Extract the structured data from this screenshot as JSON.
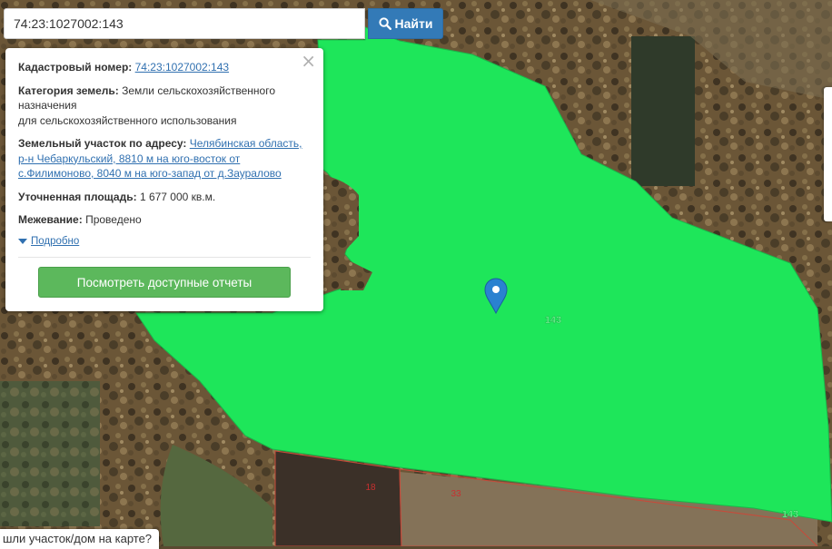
{
  "search": {
    "value": "74:23:1027002:143",
    "button_label": "Найти",
    "button_icon": "search-icon"
  },
  "popup": {
    "close_icon": "close-icon",
    "cadastral_label": "Кадастровый номер:",
    "cadastral_value": "74:23:1027002:143",
    "category_label": "Категория земель:",
    "category_line1": "Земли сельскохозяйственного",
    "category_line2": "назначения",
    "category_line3": "для сельскохозяйственного использования",
    "address_label": "Земельный участок по адресу:",
    "address_line1": "Челябинская область,",
    "address_line2": "р-н Чебаркульский, 8810 м на юго-восток от",
    "address_line3": "с.Филимоново, 8040 м на юго-запад от д.Зауралово",
    "area_label": "Уточненная площадь:",
    "area_value": "1 677 000 кв.м.",
    "survey_label": "Межевание:",
    "survey_value": "Проведено",
    "details_label": "Подробно",
    "reports_button": "Посмотреть доступные отчеты"
  },
  "map": {
    "parcel_labels": [
      "143",
      "18",
      "33",
      "143"
    ],
    "marker_icon": "map-pin-icon",
    "highlight_color": "#1ee65a"
  },
  "footer": {
    "ask_text": "шли участок/дом на карте?"
  }
}
